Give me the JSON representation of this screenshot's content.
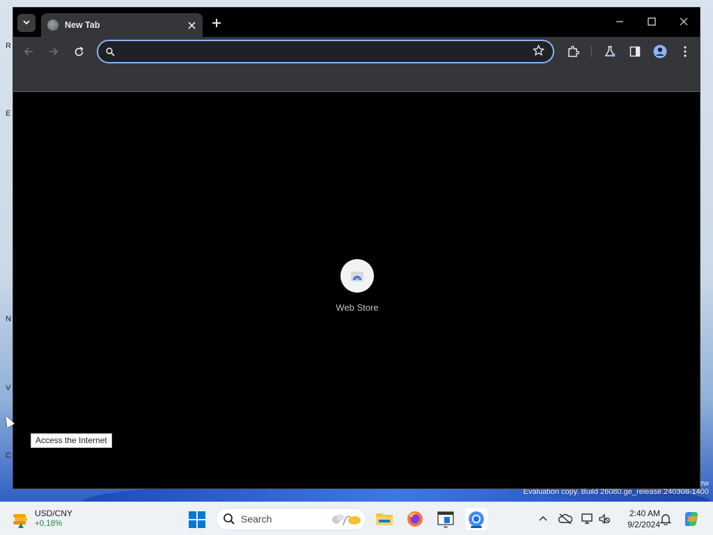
{
  "desktop": {
    "side_letters": [
      "R",
      "E",
      "N",
      "V",
      "C"
    ],
    "watermark_top": "ew",
    "watermark": "Evaluation copy. Build 26080.ge_release.240308-1400",
    "tooltip": "Access the Internet"
  },
  "browser": {
    "tab": {
      "title": "New Tab"
    },
    "omnibox": {
      "value": "",
      "placeholder": ""
    },
    "shortcuts": [
      {
        "label": "Web Store"
      }
    ]
  },
  "taskbar": {
    "widget": {
      "pair": "USD/CNY",
      "change": "+0.18%"
    },
    "search": {
      "placeholder": "Search"
    },
    "clock": {
      "time": "2:40 AM",
      "date": "9/2/2024"
    }
  },
  "colors": {
    "accent": "#8ab4f8",
    "toolbar": "#35363a",
    "titlebar": "#000000",
    "taskbar": "#eef2f7"
  }
}
